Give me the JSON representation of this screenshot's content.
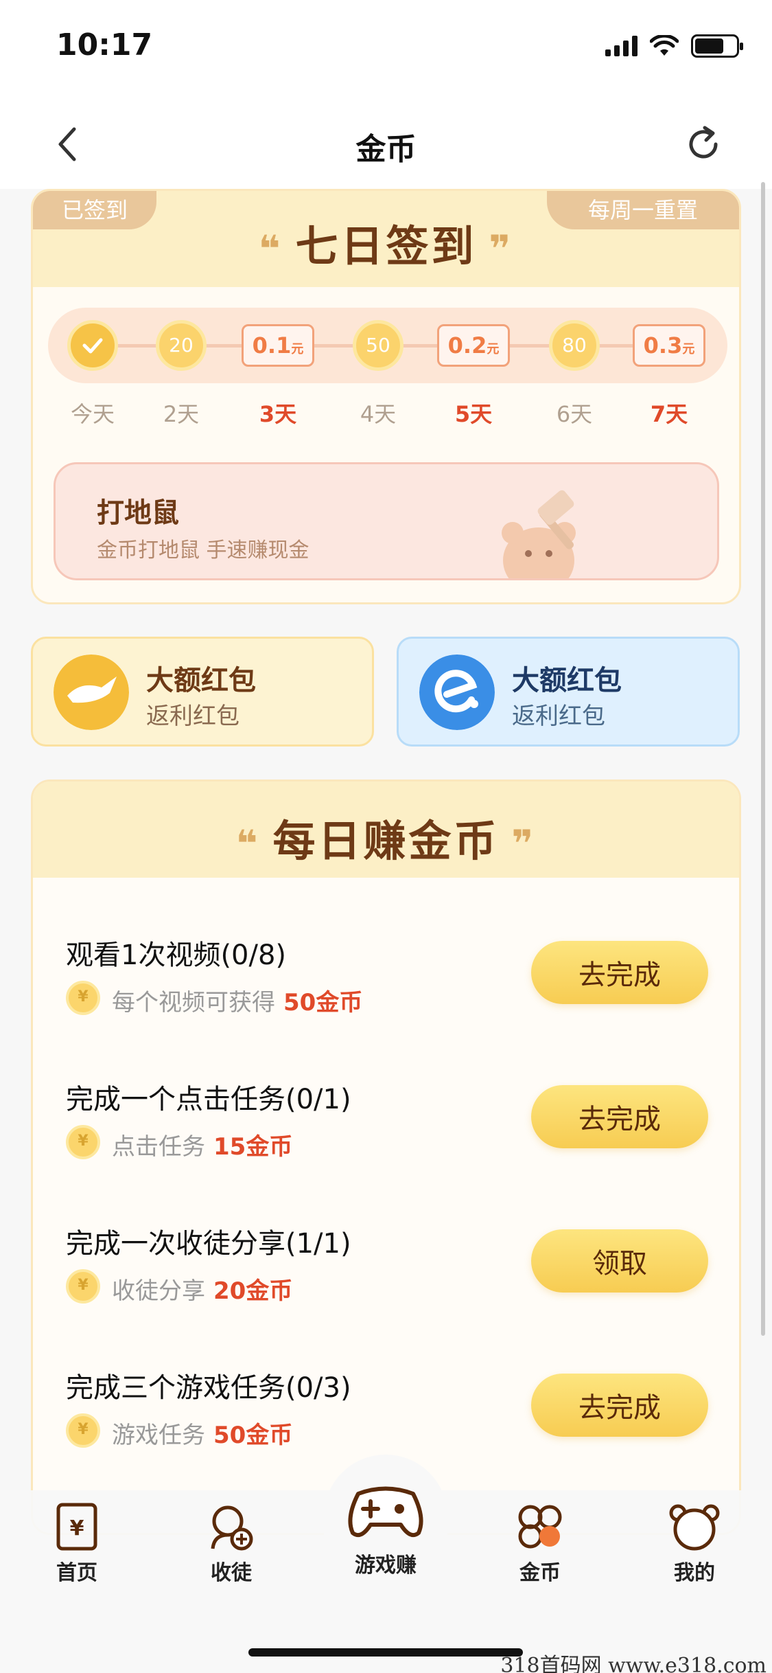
{
  "status_bar": {
    "time": "10:17"
  },
  "header": {
    "title": "金币"
  },
  "signin": {
    "badge_left": "已签到",
    "badge_right": "每周一重置",
    "title": "七日签到",
    "days": [
      {
        "label": "今天",
        "reward": "",
        "highlight": false
      },
      {
        "label": "2天",
        "reward": "20",
        "highlight": false
      },
      {
        "label": "3天",
        "reward": "0.1",
        "unit": "元",
        "highlight": true
      },
      {
        "label": "4天",
        "reward": "50",
        "highlight": false
      },
      {
        "label": "5天",
        "reward": "0.2",
        "unit": "元",
        "highlight": true
      },
      {
        "label": "6天",
        "reward": "80",
        "highlight": false
      },
      {
        "label": "7天",
        "reward": "0.3",
        "unit": "元",
        "highlight": true
      }
    ],
    "banner": {
      "title": "打地鼠",
      "subtitle": "金币打地鼠 手速赚现金"
    }
  },
  "packets": [
    {
      "title": "大额红包",
      "subtitle": "返利红包",
      "color": "#f5bd3a"
    },
    {
      "title": "大额红包",
      "subtitle": "返利红包",
      "color": "#3a8ee6"
    }
  ],
  "daily": {
    "title": "每日赚金币",
    "tasks": [
      {
        "title": "观看1次视频(0/8)",
        "desc": "每个视频可获得",
        "reward": "50金币",
        "button": "去完成"
      },
      {
        "title": "完成一个点击任务(0/1)",
        "desc": "点击任务",
        "reward": "15金币",
        "button": "去完成"
      },
      {
        "title": "完成一次收徒分享(1/1)",
        "desc": "收徒分享",
        "reward": "20金币",
        "button": "领取"
      },
      {
        "title": "完成三个游戏任务(0/3)",
        "desc": "游戏任务",
        "reward": "50金币",
        "button": "去完成"
      }
    ]
  },
  "tabbar": {
    "items": [
      {
        "label": "首页",
        "icon": "home-icon"
      },
      {
        "label": "收徒",
        "icon": "add-friend-icon"
      },
      {
        "label": "游戏赚",
        "icon": "gamepad-icon"
      },
      {
        "label": "金币",
        "icon": "clover-icon"
      },
      {
        "label": "我的",
        "icon": "bear-icon"
      }
    ]
  },
  "watermark": "318首码网 www.e318.com",
  "colors": {
    "accent": "#f7cc52",
    "brown": "#6e3a16",
    "red": "#e04a2a"
  }
}
